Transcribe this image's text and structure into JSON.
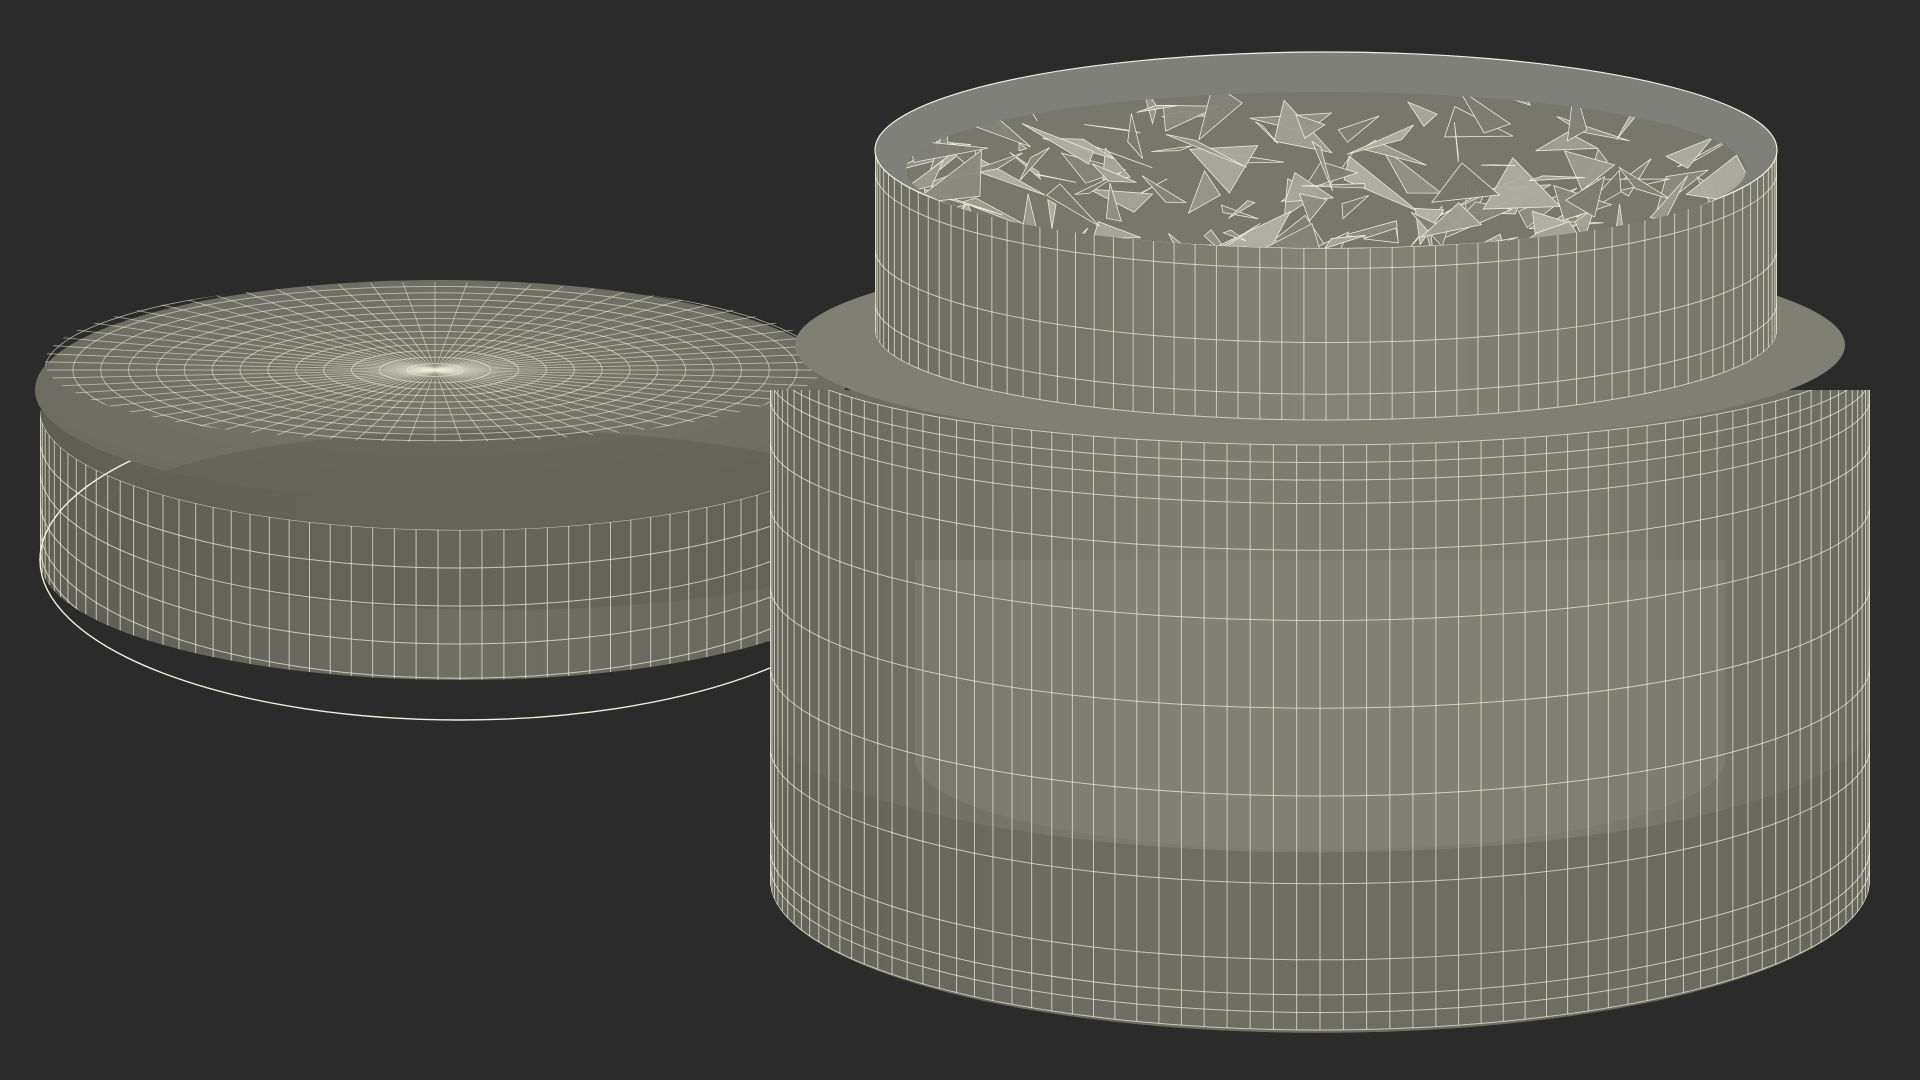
{
  "scene": {
    "background_color": "#2b2b2b",
    "render_style": "wireframe-over-shaded",
    "wire_color": "#f2f0dc",
    "objects": [
      {
        "name": "jar-lid",
        "description_shape": "flat round cap lying beside the jar",
        "surface_color": "#727266"
      },
      {
        "name": "jar-body",
        "description_shape": "round cylindrical container with a narrower threaded neck",
        "surface_color": "#7a7a6e"
      },
      {
        "name": "jar-contents",
        "description_shape": "crumpled / faceted material filling the jar opening",
        "surface_color": "#8e8e82"
      }
    ]
  }
}
